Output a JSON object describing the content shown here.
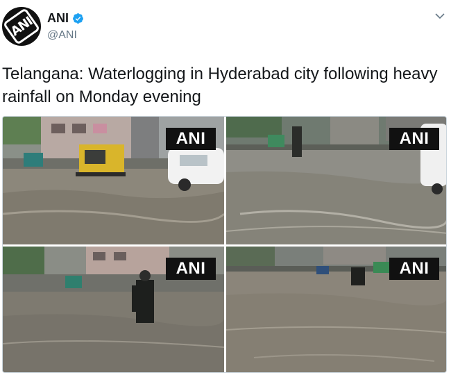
{
  "author": {
    "display_name": "ANI",
    "handle": "@ANI",
    "avatar_text": "ANI",
    "verified": true
  },
  "tweet": {
    "text": "Telangana: Waterlogging in Hyderabad city following heavy rainfall on Monday evening"
  },
  "media": {
    "photos": [
      {
        "watermark": "ANI"
      },
      {
        "watermark": "ANI"
      },
      {
        "watermark": "ANI"
      },
      {
        "watermark": "ANI"
      }
    ]
  },
  "icons": {
    "verified": "verified-badge-icon",
    "menu": "chevron-down-icon"
  },
  "colors": {
    "verified_blue": "#1da1f2",
    "handle_gray": "#657786",
    "badge_black": "#111111"
  }
}
